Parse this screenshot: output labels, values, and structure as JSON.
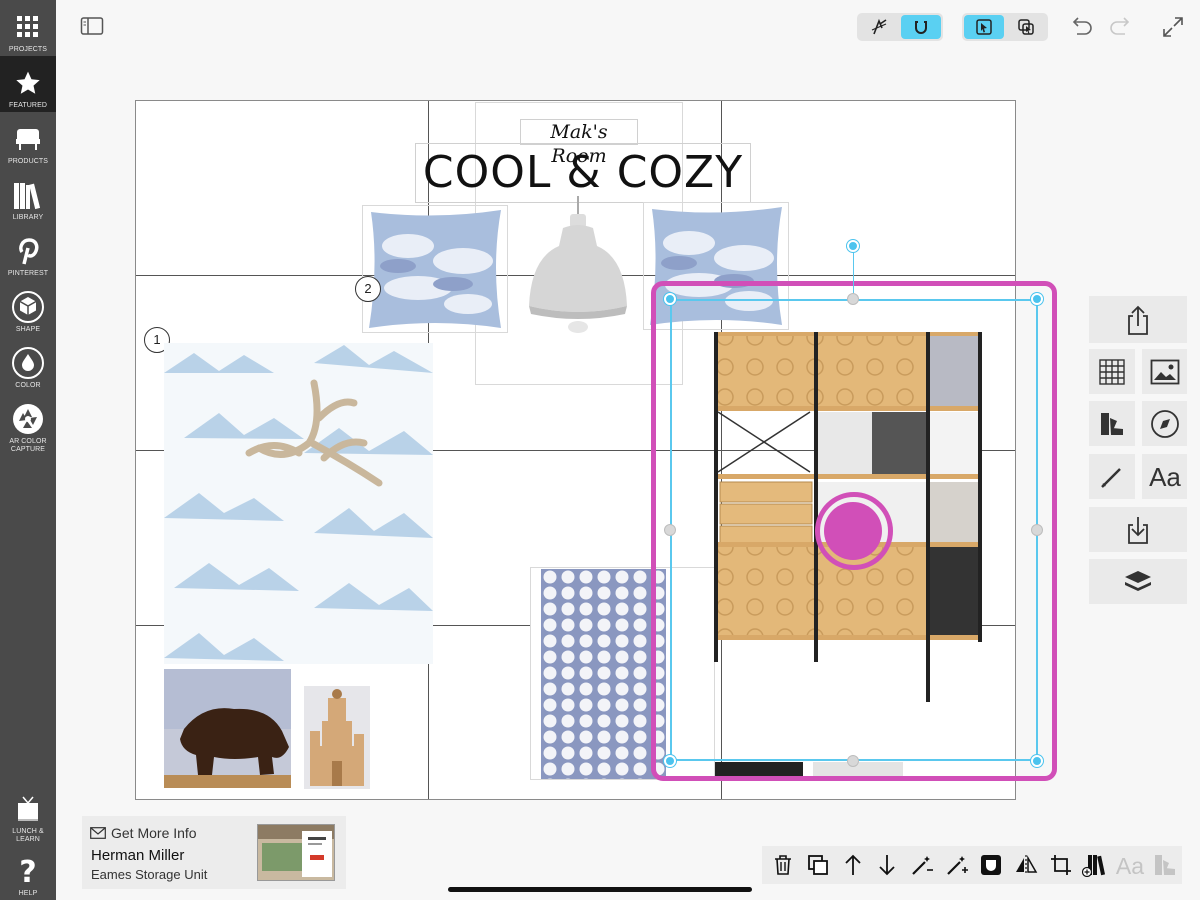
{
  "sidebar": {
    "items": [
      {
        "label": "PROJECTS",
        "icon": "grid-icon"
      },
      {
        "label": "FEATURED",
        "icon": "star-icon"
      },
      {
        "label": "PRODUCTS",
        "icon": "chair-icon"
      },
      {
        "label": "LIBRARY",
        "icon": "books-icon"
      },
      {
        "label": "PINTEREST",
        "icon": "pinterest-icon"
      },
      {
        "label": "SHAPE",
        "icon": "cube-icon"
      },
      {
        "label": "COLOR",
        "icon": "drop-icon"
      },
      {
        "label": "AR COLOR CAPTURE",
        "icon": "aperture-icon"
      }
    ],
    "bottom_items": [
      {
        "label": "LUNCH & LEARN",
        "icon": "tv-icon"
      },
      {
        "label": "HELP",
        "icon": "question-icon"
      }
    ]
  },
  "board": {
    "subtitle": "Mak's Room",
    "title": "COOL & COZY",
    "tags": [
      "1",
      "2"
    ]
  },
  "info_card": {
    "more_label": "Get More Info",
    "brand": "Herman Miller",
    "product": "Eames Storage Unit"
  },
  "colors": {
    "accent_pink": "#d14fb8",
    "accent_blue": "#5ac8ee",
    "sidebar_bg": "#4a4a4a"
  }
}
